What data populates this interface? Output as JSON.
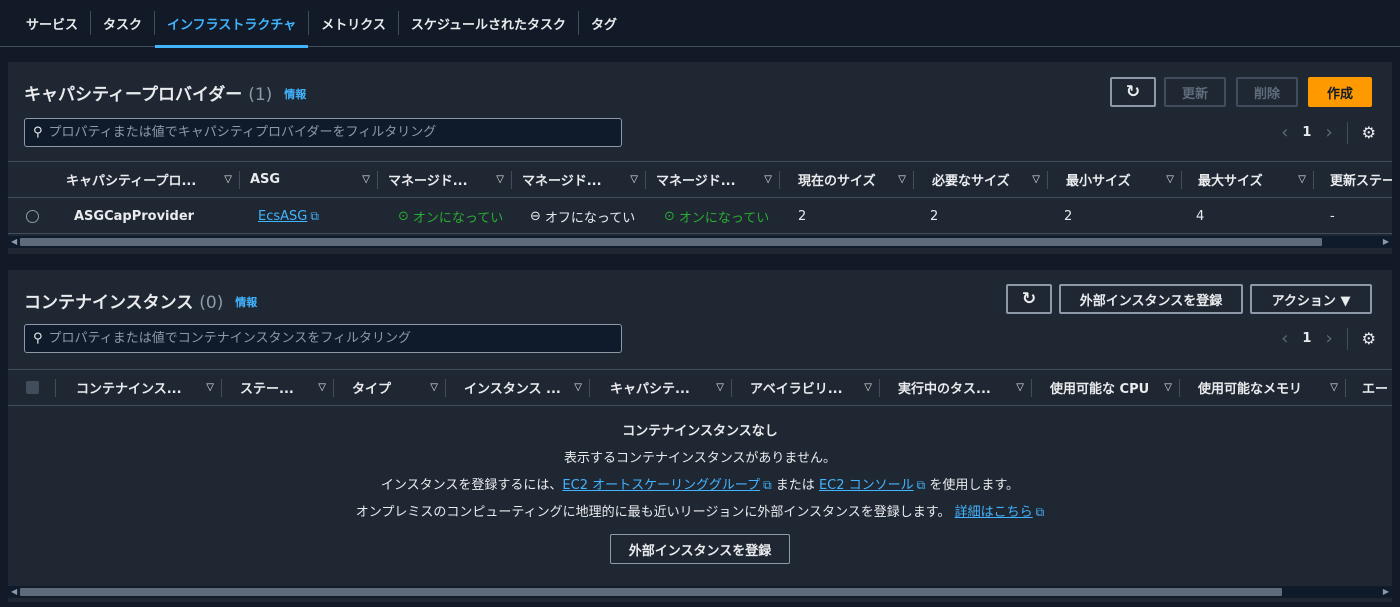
{
  "tabs": [
    {
      "label": "サービス"
    },
    {
      "label": "タスク"
    },
    {
      "label": "インフラストラクチャ",
      "active": true
    },
    {
      "label": "メトリクス"
    },
    {
      "label": "スケジュールされたタスク"
    },
    {
      "label": "タグ"
    }
  ],
  "capacity": {
    "title": "キャパシティープロバイダー",
    "count": "(1)",
    "info": "情報",
    "buttons": {
      "refresh_icon": "refresh-icon",
      "update": "更新",
      "delete": "削除",
      "create": "作成"
    },
    "filter_placeholder": "プロパティまたは値でキャパシティプロバイダーをフィルタリング",
    "page": "1",
    "columns": [
      "キャパシティープロ...",
      "ASG",
      "マネージド...",
      "マネージド...",
      "マネージド...",
      "現在のサイズ",
      "必要なサイズ",
      "最小サイズ",
      "最大サイズ",
      "更新ステー"
    ],
    "row": {
      "name": "ASGCapProvider",
      "asg": "EcsASG",
      "m1": "オンになってい",
      "m2": "オフになってい",
      "m3": "オンになってい",
      "current": "2",
      "desired": "2",
      "min": "2",
      "max": "4",
      "update_status": "-"
    }
  },
  "instances": {
    "title": "コンテナインスタンス",
    "count": "(0)",
    "info": "情報",
    "buttons": {
      "register": "外部インスタンスを登録",
      "actions": "アクション ▼"
    },
    "filter_placeholder": "プロパティまたは値でコンテナインスタンスをフィルタリング",
    "page": "1",
    "columns": [
      "コンテナインス...",
      "ステー...",
      "タイプ",
      "インスタンス ...",
      "キャパシテ...",
      "アベイラビリ...",
      "実行中のタス...",
      "使用可能な CPU",
      "使用可能なメモリ",
      "エー"
    ],
    "empty": {
      "title": "コンテナインスタンスなし",
      "line1": "表示するコンテナインスタンスがありません。",
      "line2_pre": "インスタンスを登録するには、",
      "line2_link1": "EC2 オートスケーリンググループ",
      "line2_mid": "または",
      "line2_link2": "EC2 コンソール",
      "line2_post": "を使用します。",
      "line3_pre": "オンプレミスのコンピューティングに地理的に最も近いリージョンに外部インスタンスを登録します。",
      "line3_link": "詳細はこちら",
      "button": "外部インスタンスを登録"
    }
  },
  "colors": {
    "accent": "#42b4ff",
    "primary": "#ff9900",
    "success": "#29ad32"
  }
}
